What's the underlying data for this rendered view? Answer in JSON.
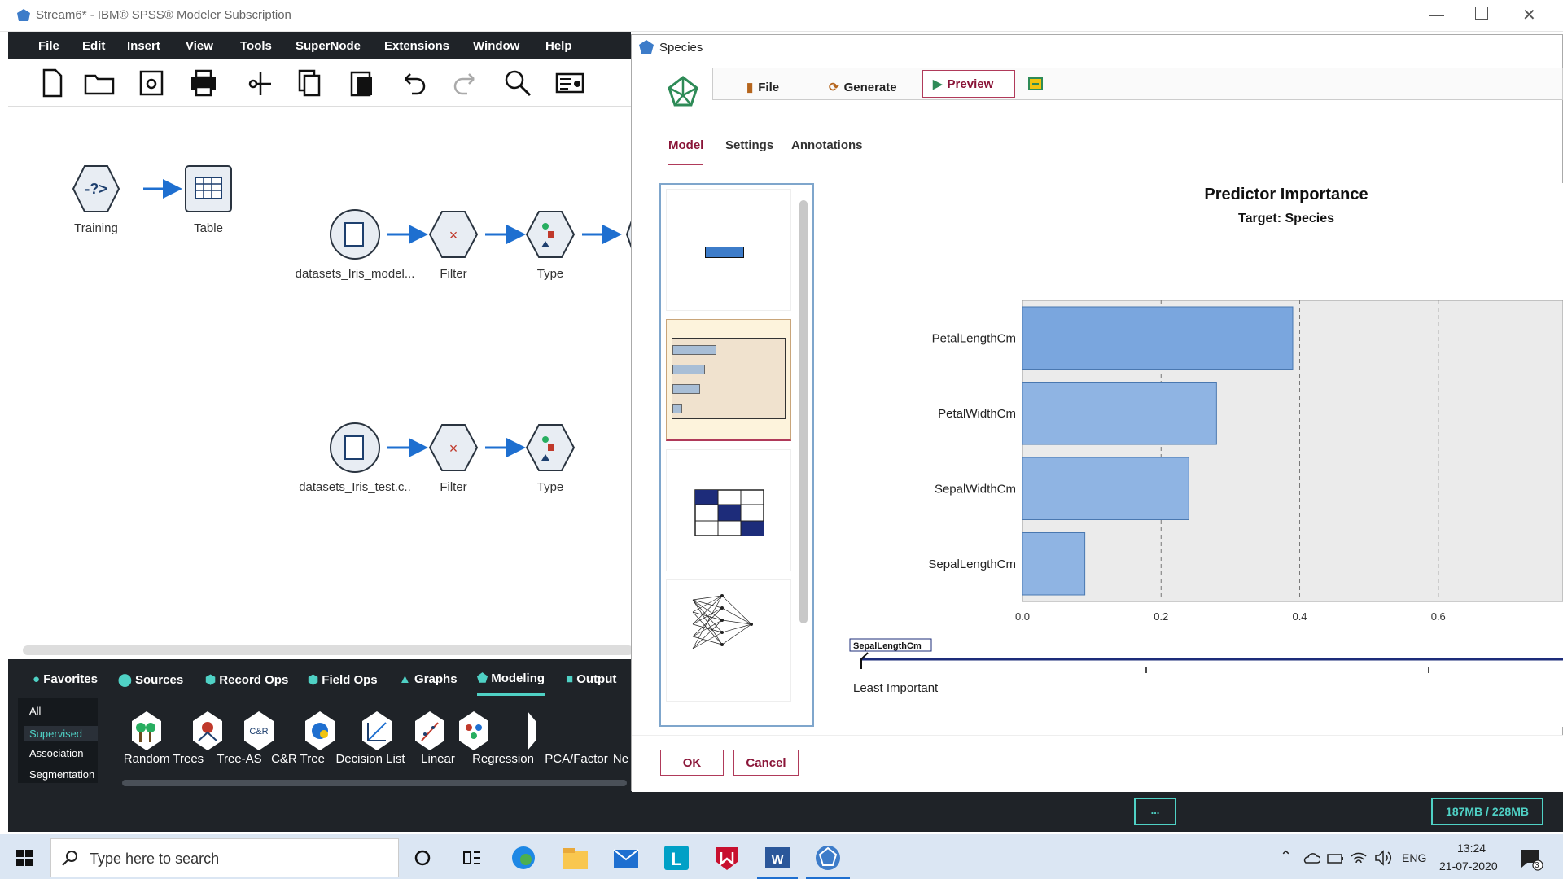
{
  "app": {
    "title": "Stream6* - IBM® SPSS® Modeler Subscription",
    "menu": [
      "File",
      "Edit",
      "Insert",
      "View",
      "Tools",
      "SuperNode",
      "Extensions",
      "Window",
      "Help"
    ]
  },
  "canvas": {
    "nodes": {
      "training": "Training",
      "table": "Table",
      "model_source": "datasets_Iris_model...",
      "filter1": "Filter",
      "type1": "Type",
      "test_source": "datasets_Iris_test.c..",
      "filter2": "Filter",
      "type2": "Type"
    }
  },
  "palette": {
    "tabs": [
      "Favorites",
      "Sources",
      "Record Ops",
      "Field Ops",
      "Graphs",
      "Modeling",
      "Output"
    ],
    "active_tab": "Modeling",
    "categories": [
      "All",
      "Supervised",
      "Association",
      "Segmentation"
    ],
    "active_category": "Supervised",
    "nodes": [
      "Random Trees",
      "Tree-AS",
      "C&R Tree",
      "Decision List",
      "Linear",
      "Regression",
      "PCA/Factor",
      "Ne"
    ]
  },
  "status": {
    "ellipsis": "...",
    "memory": "187MB / 228MB"
  },
  "dialog": {
    "title": "Species",
    "toolbar": {
      "file": "File",
      "generate": "Generate",
      "preview": "Preview"
    },
    "tabs": [
      "Model",
      "Settings",
      "Annotations"
    ],
    "active_tab": "Model",
    "ok": "OK",
    "cancel": "Cancel"
  },
  "chart_data": {
    "type": "bar",
    "orientation": "horizontal",
    "title": "Predictor Importance",
    "subtitle": "Target: Species",
    "categories": [
      "PetalLengthCm",
      "PetalWidthCm",
      "SepalWidthCm",
      "SepalLengthCm"
    ],
    "values": [
      0.39,
      0.28,
      0.24,
      0.09
    ],
    "xlim": [
      0,
      0.78
    ],
    "xticks": [
      "0.0",
      "0.2",
      "0.4",
      "0.6"
    ],
    "grid": true,
    "slider_label": "SepalLengthCm",
    "least_label": "Least Important",
    "bar_color": "#8fb4e3",
    "top_bar_color": "#7aa6de"
  },
  "taskbar": {
    "search_placeholder": "Type here to search",
    "lang": "ENG",
    "time": "13:24",
    "date": "21-07-2020",
    "notif_count": "3"
  },
  "colors": {
    "dark_bar": "#1f2328",
    "accent_teal": "#4fd1c5",
    "preview_border": "#b03a5a"
  }
}
